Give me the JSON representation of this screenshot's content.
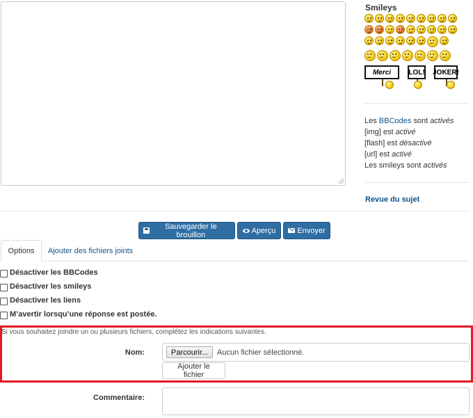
{
  "editor": {
    "value": ""
  },
  "sidebar": {
    "smileys_title": "Smileys",
    "smiley_rows": [
      [
        "smile-icon",
        "laugh-icon",
        "grin-icon",
        "wink-icon",
        "shocked-icon",
        "confused-icon",
        "cool-icon",
        "tongue-icon",
        "neutral-icon"
      ],
      [
        "mad-icon",
        "red-face-icon",
        "sad-icon",
        "angry-icon",
        "evil-icon",
        "exclaim-icon",
        "question-icon",
        "idea-icon",
        "arrow-icon"
      ],
      [
        "rolleyes-icon",
        "razz-icon",
        "geek-icon",
        "nerd-icon",
        "sleepy-icon",
        "music-icon",
        "thinking-icon",
        "yellow-flag-icon"
      ],
      [
        "chat-icon",
        "zzz-icon",
        "ghost-icon",
        "hug-icon",
        "star-icon",
        "shy-icon",
        "bomb-icon"
      ]
    ],
    "signs": [
      "Merci",
      "LOL!",
      "JOKER!"
    ],
    "bbcodes": {
      "line1_pre": "Les ",
      "line1_link": "BBCodes",
      "line1_mid": " sont ",
      "line1_state": "activés",
      "line2_pre": "[img] est ",
      "line2_state": "activé",
      "line3_pre": "[flash] est ",
      "line3_state": "désactivé",
      "line4_pre": "[url] est ",
      "line4_state": "activé",
      "line5_pre": "Les smileys sont ",
      "line5_state": "activés"
    },
    "topic_review": "Revue du sujet"
  },
  "toolbar": {
    "save_label": "Sauvegarder le brouillon",
    "preview_label": "Aperçu",
    "submit_label": "Envoyer"
  },
  "tabs": [
    {
      "label": "Options",
      "active": true
    },
    {
      "label": "Ajouter des fichiers joints",
      "active": false
    }
  ],
  "options": [
    {
      "label": "Désactiver les BBCodes",
      "checked": false
    },
    {
      "label": "Désactiver les smileys",
      "checked": false
    },
    {
      "label": "Désactiver les liens",
      "checked": false
    },
    {
      "label": "M’avertir lorsqu’une réponse est postée.",
      "checked": false
    }
  ],
  "attachments": {
    "hint": "Si vous souhaitez joindre un ou plusieurs fichiers, complétez les indications suivantes.",
    "name_label": "Nom:",
    "browse_label": "Parcourir...",
    "no_file_label": "Aucun fichier sélectionné.",
    "add_file_label": "Ajouter le fichier",
    "comment_label": "Commentaire:",
    "comment_value": ""
  },
  "colors": {
    "accent": "#2f6ea3",
    "link": "#105289",
    "highlight_border": "#e01a22"
  }
}
